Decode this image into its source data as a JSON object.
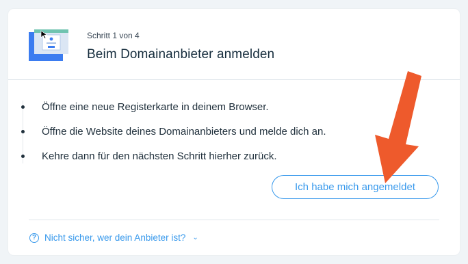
{
  "header": {
    "step_label": "Schritt 1 von 4",
    "title": "Beim Domainanbieter anmelden",
    "illustration_icon": "browser-login-illustration-icon"
  },
  "instructions": [
    {
      "text": "Öffne eine neue Registerkarte in deinem Browser."
    },
    {
      "text": "Öffne die Website deines Domainanbieters und melde dich an."
    },
    {
      "text": "Kehre dann für den nächsten Schritt hierher zurück."
    }
  ],
  "primary_button": {
    "label": "Ich habe mich angemeldet"
  },
  "help": {
    "label": "Nicht sicher, wer dein Anbieter ist?",
    "icon": "question-circle-icon",
    "chevron": "chevron-down-icon"
  },
  "colors": {
    "accent": "#3899ec",
    "annotation_arrow": "#ee5a2c"
  }
}
